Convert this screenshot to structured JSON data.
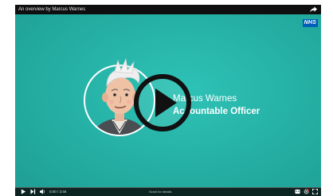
{
  "video": {
    "title": "An overview by Marcus Warnes",
    "badge": "NHS",
    "caption_name": "Marcus Warnes",
    "caption_role": "Accountable Officer",
    "time_display": "0:00 / 3:46",
    "scroll_hint": "Scroll for details"
  },
  "colors": {
    "background": "#26b3a8",
    "nhs_blue": "#005eb8",
    "play_button": "#111111"
  },
  "icons": {
    "share": "share-icon",
    "play": "play-icon",
    "pause_play_small": "play-small-icon",
    "next": "next-icon",
    "volume": "volume-icon",
    "captions": "captions-icon",
    "settings": "settings-icon",
    "fullscreen": "fullscreen-icon"
  }
}
